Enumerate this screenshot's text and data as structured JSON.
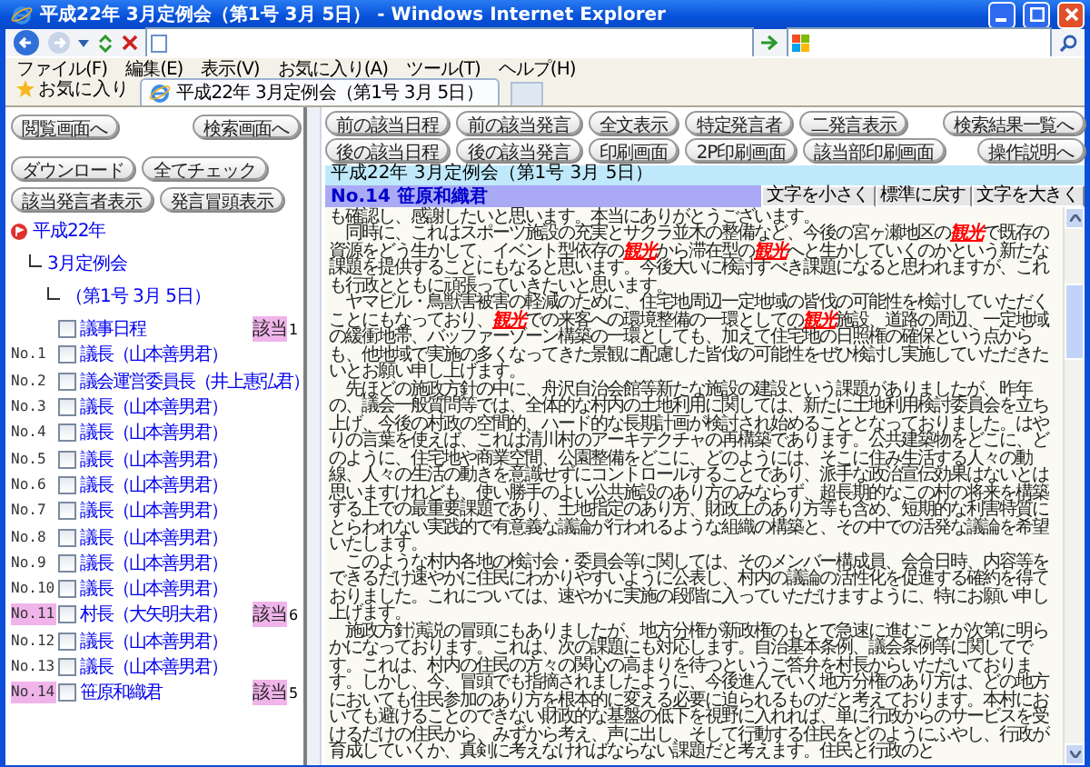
{
  "window": {
    "title": "平成22年 3月定例会（第1号 3月 5日） - Windows Internet Explorer"
  },
  "menu": [
    "ファイル(F)",
    "編集(E)",
    "表示(V)",
    "お気に入り(A)",
    "ツール(T)",
    "ヘルプ(H)"
  ],
  "favorites": {
    "label": "お気に入り",
    "tab": "平成22年 3月定例会（第1号 3月 5日）"
  },
  "left": {
    "nav_buttons": [
      "閲覧画面へ",
      "検索画面へ"
    ],
    "action_buttons": [
      "ダウンロード",
      "全てチェック",
      "該当発言者表示",
      "発言冒頭表示"
    ],
    "tree": [
      {
        "label": "平成22年",
        "children": [
          {
            "label": "3月定例会",
            "children": [
              {
                "label": "（第1号 3月 5日）"
              }
            ]
          }
        ]
      }
    ],
    "speakers": [
      {
        "name": "議事日程",
        "checked": false,
        "matched": true,
        "badge": "該当",
        "count": "1"
      },
      {
        "number": "No.1",
        "name": "議長（山本善男君）",
        "checked": false,
        "matched": false
      },
      {
        "number": "No.2",
        "name": "議会運営委員長（井上惠弘君）",
        "checked": false,
        "matched": false
      },
      {
        "number": "No.3",
        "name": "議長（山本善男君）",
        "checked": false,
        "matched": false
      },
      {
        "number": "No.4",
        "name": "議長（山本善男君）",
        "checked": false,
        "matched": false
      },
      {
        "number": "No.5",
        "name": "議長（山本善男君）",
        "checked": false,
        "matched": false
      },
      {
        "number": "No.6",
        "name": "議長（山本善男君）",
        "checked": false,
        "matched": false
      },
      {
        "number": "No.7",
        "name": "議長（山本善男君）",
        "checked": false,
        "matched": false
      },
      {
        "number": "No.8",
        "name": "議長（山本善男君）",
        "checked": false,
        "matched": false
      },
      {
        "number": "No.9",
        "name": "議長（山本善男君）",
        "checked": false,
        "matched": false
      },
      {
        "number": "No.10",
        "name": "議長（山本善男君）",
        "checked": false,
        "matched": false
      },
      {
        "number": "No.11",
        "name": "村長（大矢明夫君）",
        "checked": false,
        "matched": true,
        "badge": "該当",
        "count": "6"
      },
      {
        "number": "No.12",
        "name": "議長（山本善男君）",
        "checked": false,
        "matched": false
      },
      {
        "number": "No.13",
        "name": "議長（山本善男君）",
        "checked": false,
        "matched": false
      },
      {
        "number": "No.14",
        "name": "笹原和織君",
        "checked": false,
        "matched": true,
        "badge": "該当",
        "count": "5"
      }
    ]
  },
  "right": {
    "button_rows": [
      [
        "前の該当日程",
        "前の該当発言",
        "全文表示",
        "特定発言者",
        "二発言表示",
        "検索結果一覧へ"
      ],
      [
        "後の該当日程",
        "後の該当発言",
        "印刷画面",
        "2P印刷画面",
        "該当部印刷画面",
        "操作説明へ"
      ]
    ],
    "session_title": "平成22年 3月定例会（第1号 3月 5日）",
    "speaker": {
      "title": "No.14 笹原和織君",
      "font_buttons": [
        "文字を小さく",
        "標準に戻す",
        "文字を大きく"
      ]
    },
    "paragraphs": [
      "も確認し、感謝したいと思います。本当にありがとうございます。",
      "　同時に、これはスポーツ施設の充実とサクラ並木の整備など、今後の宮ヶ瀬地区の**観光**で既存の資源をどう生かして、イベント型依存の**観光**から滞在型の**観光**へと生かしていくのかという新たな課題を提供することにもなると思います。今後大いに検討すべき課題になると思われますが、これも行政とともに頑張っていきたいと思います。",
      "　ヤマビル・鳥獣害被害の軽減のために、住宅地周辺一定地域の皆伐の可能性を検討していただくことにもなっており、**観光**での来客への環境整備の一環としての**観光**施設、道路の周辺、一定地域の緩衝地帯、バッファーゾーン構築の一環としても、加えて住宅地の日照権の確保という点からも、他地域で実施の多くなってきた景観に配慮した皆伐の可能性をぜひ検討し実施していただきたいとお願い申し上げます。",
      "　先ほどの施政方針の中に、舟沢自治会館等新たな施設の建設という課題がありましたが、昨年の、議会一般質問等では、全体的な村内の土地利用に関しては、新たに土地利用検討委員会を立ち上げ、今後の村政の空間的、ハード的な長期計画が検討され始めることとなっておりました。はやりの言葉を使えば、これは清川村のアーキテクチャの再構築であります。公共建築物をどこに、どのように、住宅地や商業空間、公園整備をどこに、どのようには、そこに住み生活する人々の動線、人々の生活の動きを意識せずにコントロールすることであり、派手な政治宣伝効果はないとは思いますけれども、使い勝手のよい公共施設のあり方のみならず、超長期的なこの村の将来を構築する上での最重要課題であり、土地指定のあり方、財政上のあり方等も含め、短期的な利害特質にとらわれない実践的で有意義な議論が行われるような組織の構築と、その中での活発な議論を希望いたします。",
      "　このような村内各地の検討会・委員会等に関しては、そのメンバー構成員、会合日時、内容等をできるだけ速やかに住民にわかりやすいように公表し、村内の議論の活性化を促進する確約を得ておりました。これについては、速やかに実施の段階に入っていただけますように、特にお願い申し上げます。",
      "　施政方針演説の冒頭にもありましたが、地方分権が新政権のもとで急速に進むことが次第に明らかになっております。これは、次の課題にも対応します。自治基本条例、議会条例等に関してです。これは、村内の住民の方々の関心の高まりを待つというご答弁を村長からいただいております。しかし、今、冒頭でも指摘されましたように、今後進んでいく地方分権のあり方は、どの地方においても住民参加のあり方を根本的に変える必要に迫られるものだと考えております。本村においても避けることのできない財政的な基盤の低下を視野に入れれば、単に行政からのサービスを受けるだけの住民から、みずから考え、声に出し、そして行動する住民をどのようにふやし、行政が育成していくか、真剣に考えなければならない課題だと考えます。住民と行政のと"
    ]
  }
}
